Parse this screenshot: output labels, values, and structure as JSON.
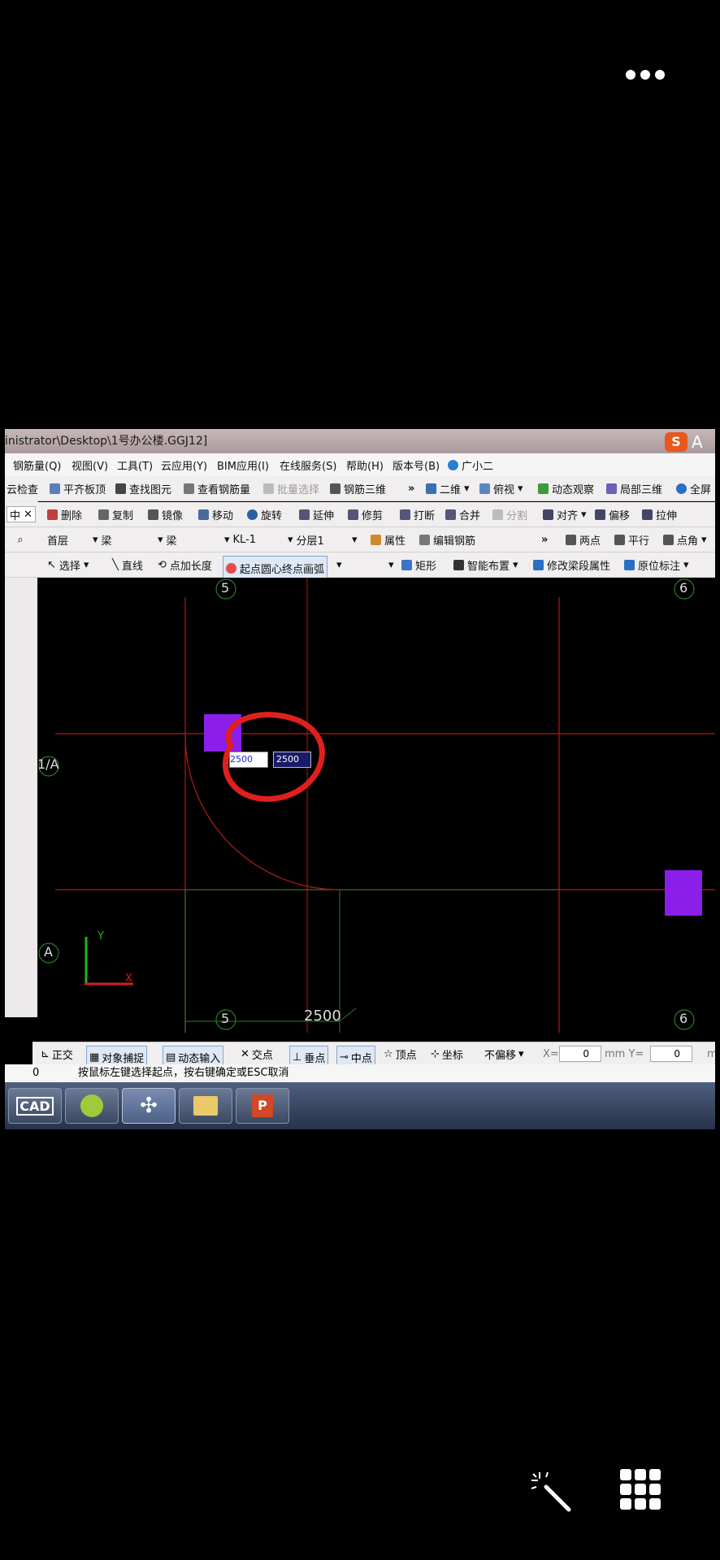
{
  "phone": {
    "more_icon": "more-dots-icon",
    "magic_icon": "magic-wand-icon",
    "apps_icon": "app-grid-icon"
  },
  "window": {
    "title": "inistrator\\Desktop\\1号办公楼.GGJ12]",
    "logo_letter": "S",
    "logo_text": "A"
  },
  "menu": [
    "钢筋量(Q)",
    "视图(V)",
    "工具(T)",
    "云应用(Y)",
    "BIM应用(I)",
    "在线服务(S)",
    "帮助(H)",
    "版本号(B)",
    "广小二"
  ],
  "toolbar1": {
    "items": [
      "云检查",
      "平齐板顶",
      "查找图元",
      "查看钢筋量",
      "批量选择",
      "钢筋三维",
      "»",
      "二维",
      "俯视",
      "动态观察",
      "局部三维",
      "全屏"
    ]
  },
  "toolbar2": {
    "tab_label": "中",
    "items": [
      "删除",
      "复制",
      "镜像",
      "移动",
      "旋转",
      "延伸",
      "修剪",
      "打断",
      "合并",
      "分割",
      "对齐",
      "偏移",
      "拉伸"
    ]
  },
  "toolbar3": {
    "floor": "首层",
    "category": "梁",
    "type": "梁",
    "element": "KL-1",
    "layer": "分层1",
    "property": "属性",
    "edit_rebar": "编辑钢筋",
    "more": "»",
    "right_items": [
      "两点",
      "平行",
      "点角"
    ]
  },
  "toolbar4": {
    "items": [
      "选择",
      "直线",
      "点加长度",
      "起点圆心终点画弧",
      "矩形",
      "智能布置",
      "修改梁段属性",
      "原位标注"
    ]
  },
  "canvas": {
    "grid_labels": {
      "col5_top": "5",
      "col6_top": "6",
      "row_1a": "1/A",
      "row_a": "A",
      "col5_bottom": "5",
      "col6_bottom": "6"
    },
    "dimension": "2500",
    "input_x": "2500",
    "input_y": "2500",
    "axis_y": "Y",
    "axis_x": "X"
  },
  "status": {
    "items": [
      "正交",
      "对象捕捉",
      "动态输入",
      "交点",
      "垂点",
      "中点",
      "顶点",
      "坐标"
    ],
    "offset": "不偏移",
    "x_label": "X=",
    "x_value": "0",
    "y_label": "mm Y=",
    "y_value": "0",
    "unit": "m"
  },
  "hint": {
    "count": "0",
    "text": "按鼠标左键选择起点，按右键确定或ESC取消"
  },
  "taskbar": [
    "cad-app-icon",
    "glodon-icon",
    "network-icon",
    "folder-icon",
    "powerpoint-icon"
  ],
  "colors": {
    "grid_red": "#b21a1a",
    "grid_green": "#2c7a2c",
    "column_purple": "#8b1ee8",
    "annotation_red": "#e0201c"
  }
}
